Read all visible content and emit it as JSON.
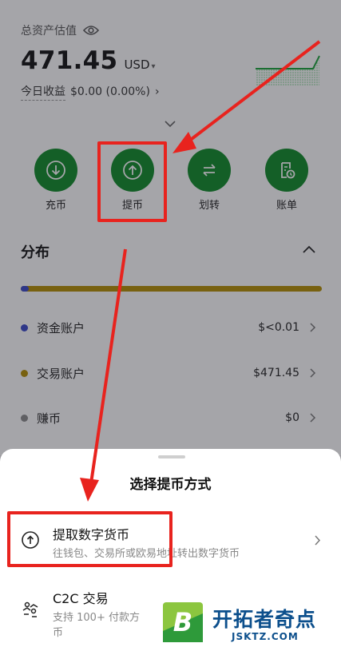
{
  "header": {
    "asset_label": "总资产估值",
    "balance": "471.45",
    "unit": "USD",
    "pnl_label": "今日收益",
    "pnl_value": "$0.00 (0.00%)"
  },
  "actions": [
    {
      "label": "充币",
      "icon": "deposit-arrow-down-icon"
    },
    {
      "label": "提币",
      "icon": "withdraw-arrow-up-icon"
    },
    {
      "label": "划转",
      "icon": "transfer-arrows-icon"
    },
    {
      "label": "账单",
      "icon": "bill-document-icon"
    }
  ],
  "distribution": {
    "title": "分布",
    "accounts": [
      {
        "name": "资金账户",
        "value": "$<0.01",
        "color": "#3a49c8"
      },
      {
        "name": "交易账户",
        "value": "$471.45",
        "color": "#b58e00"
      },
      {
        "name": "赚币",
        "value": "$0",
        "color": "#8a8a8a"
      }
    ]
  },
  "sheet": {
    "title": "选择提币方式",
    "options": [
      {
        "title": "提取数字货币",
        "desc": "往钱包、交易所或欧易地址转出数字货币",
        "icon": "withdraw-circle-icon"
      },
      {
        "title": "C2C 交易",
        "desc_line1": "支持 100+ 付款方",
        "desc_line2": "币",
        "icon": "c2c-people-icon"
      }
    ]
  },
  "watermark": {
    "logo_letter": "B",
    "text": "开拓者奇点",
    "domain": "JSKTZ.COM"
  },
  "colors": {
    "action_green": "#0e8a27",
    "highlight_red": "#e8231e",
    "accent_gold": "#b58e00"
  }
}
